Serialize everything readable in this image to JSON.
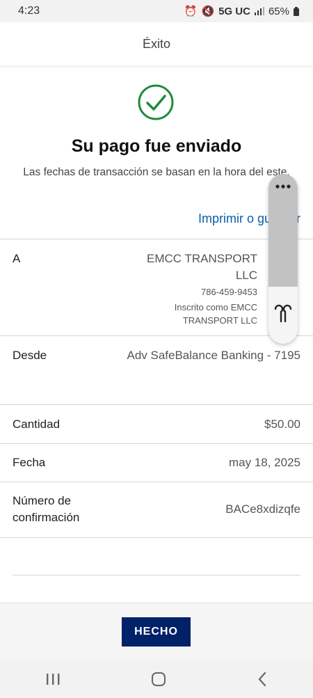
{
  "status_bar": {
    "time": "4:23",
    "network": "5G UC",
    "battery": "65%"
  },
  "header": {
    "title": "Éxito"
  },
  "confirmation": {
    "title": "Su pago fue enviado",
    "subtitle": "Las fechas de transacción se basan en la hora del este.",
    "print_link": "Imprimir o guardar"
  },
  "details": {
    "to_label": "A",
    "to_name": "EMCC TRANSPORT LLC",
    "to_phone": "786-459-9453",
    "to_enrolled": "Inscrito como EMCC TRANSPORT LLC",
    "from_label": "Desde",
    "from_value": "Adv SafeBalance Banking - 7195",
    "amount_label": "Cantidad",
    "amount_value": "$50.00",
    "date_label": "Fecha",
    "date_value": "may 18, 2025",
    "confirmation_label": "Número de confirmación",
    "confirmation_value": "BACe8xdizqfe"
  },
  "footer": {
    "done_label": "HECHO"
  },
  "colors": {
    "accent": "#012169",
    "link": "#0a5ea8",
    "success": "#1f8a3b"
  }
}
